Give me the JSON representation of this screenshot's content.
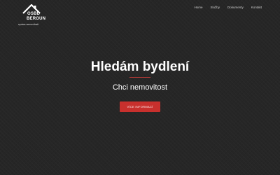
{
  "header": {
    "logo": {
      "line1": "OSBD",
      "line2": "BEROUN",
      "tagline": "správa nemovitostí"
    },
    "nav": {
      "items": [
        "Home",
        "Služby",
        "Dokumenty",
        "Kontakt"
      ]
    }
  },
  "hero": {
    "title": "Hledám bydlení",
    "subtitle": "Chci nemovitost",
    "cta_label": "VÍCE INFORMACÍ"
  },
  "colors": {
    "background": "#262626",
    "accent": "#c8302d"
  }
}
